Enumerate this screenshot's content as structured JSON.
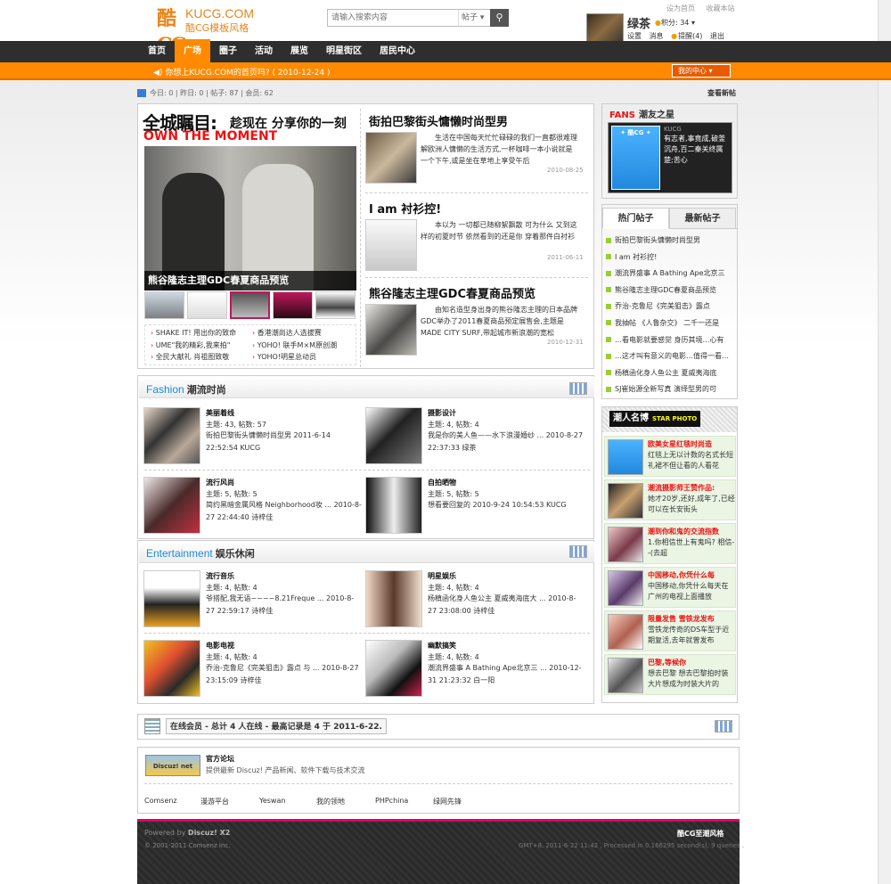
{
  "header": {
    "logo_mark": "酷CG",
    "site_name": "KUCG.COM",
    "site_sub": "酷CG模板风格",
    "top_links": [
      "设为首页",
      "收藏本站"
    ],
    "search": {
      "placeholder": "请输入搜索内容",
      "scope": "帖子",
      "button_icon": "search-icon"
    },
    "user": {
      "name": "绿茶",
      "points_label": "积分: 34",
      "menu": [
        "设置",
        "消息",
        "提醒(4)",
        "退出"
      ]
    }
  },
  "nav": {
    "items": [
      "首页",
      "广场",
      "圈子",
      "活动",
      "展览",
      "明星街区",
      "居民中心"
    ],
    "active": "广场"
  },
  "notice": {
    "text": "你想上KUCG.COM的首页吗?  ( 2010-12-24 )",
    "my_center": "我的中心"
  },
  "stats": {
    "text": "今日: 0  |  昨日: 0  |  帖子: 87  |  会员: 62",
    "newest_link": "查看新帖"
  },
  "feature": {
    "big_title": "全城瞩目:",
    "big_title_sub": "趁现在 分享你的一刻",
    "own": "OWN THE MOMENT",
    "hero_caption": "熊谷隆志主理GDC春夏商品预览",
    "list": [
      "SHAKE IT! 用出你的致命",
      "香港潮尚达人选拔赛",
      "UME\"我的精彩,我来拍\"",
      "YOHO! 联手M×M原创潮",
      "全民大献礼 肖祖图致敬",
      "YOHO!明星总动员"
    ]
  },
  "articles": [
    {
      "title": "街拍巴黎街头慵懒时尚型男",
      "text": "生活在中国每天忙忙碌碌的我们一直都很难理解欧洲人慵懒的生活方式,一杯咖啡一本小说就是一个下午,或是坐在草地上享受午后",
      "date": "2010-08-25"
    },
    {
      "title": "I am 衬衫控!",
      "text": "本以为 一切都已随柳絮飘散 可为什么 又到这样的初夏时节 依然看到的还是你 穿着那件白衬衫",
      "date": "2011-06-11"
    },
    {
      "title": "熊谷隆志主理GDC春夏商品预览",
      "text": "由知名造型身出身的熊谷隆志主理的日本品牌GDC举办了2011春夏商品预定展售会,主题是MADE CITY SURF,带起城市新浪潮的宽松",
      "date": "2010-12-31"
    }
  ],
  "fans": {
    "title": "FANS",
    "title2": "潮友之星",
    "label": "KUCG",
    "text": "有志者,事竟成,破釜沉舟,百二秦关终属楚;苦心"
  },
  "hot": {
    "tabs": [
      "热门帖子",
      "最新帖子"
    ],
    "items": [
      "街拍巴黎街头慵懒时尚型男",
      "I am 衬衫控!",
      "潮流界盛事 A Bathing Ape北京三",
      "熊谷隆志主理GDC春夏商品预览",
      "乔治-克鲁尼《完美狙击》露点",
      "我抽帖 《人鲁杂交》 二千一还是",
      "…看电影就要感觉 身历其境…心有",
      "…这才叫有意义的电影…值得一看…",
      "杨稹函化身人鱼公主 夏威夷海底",
      "SJ崔始源全新写真 演绎型男的可"
    ]
  },
  "star": {
    "tag": "潮人名博",
    "tag_en": "STAR PHOTO",
    "items": [
      {
        "title": "欧美女星红毯时尚造",
        "text": "红毯上无以计数的名式长短礼裙不但让看的人看花"
      },
      {
        "title": "潮流摄影师王赞作品:",
        "text": "她才20岁,还好,成年了,已经可以在长安街头"
      },
      {
        "title": "潮到你和鬼的交流指数",
        "text": "1.你相信世上有鬼吗?      相信--(去超"
      },
      {
        "title": "中国移动,你凭什么每",
        "text": "中国移动,你凭什么每天在广州的电视上面播放"
      },
      {
        "title": "限量发售 雪铁龙发布",
        "text": "雪铁龙传奇的DS车型于近期复活,去年就曾发布"
      },
      {
        "title": "巴黎,等候你",
        "text": "想去巴黎 想去巴黎拍时装大片想成为时装大片的"
      }
    ]
  },
  "sections": [
    {
      "title_en": "Fashion",
      "title_cn": "潮流时尚",
      "forums": [
        {
          "name": "美丽着线",
          "stats": "主题: 43, 帖数: 57",
          "last": "街拍巴黎街头慵懒时尚型男 2011-6-14 22:52:54 KUCG"
        },
        {
          "name": "摄影设计",
          "stats": "主题: 4, 帖数: 4",
          "last": "我是你的美人鱼——水下浪漫婚纱 ... 2010-8-27 22:37:33 绿茶"
        },
        {
          "name": "流行风尚",
          "stats": "主题: 5, 帖数: 5",
          "last": "简约黑暗金属风格 Neighborhood妆 ... 2010-8-27 22:44:40 诗梓佳"
        },
        {
          "name": "自拍晒物",
          "stats": "主题: 5, 帖数: 5",
          "last": "想看要回复的 2010-9-24 10:54:53 KUCG"
        }
      ]
    },
    {
      "title_en": "Entertainment",
      "title_cn": "娱乐休闲",
      "forums": [
        {
          "name": "流行音乐",
          "stats": "主题: 4, 帖数: 4",
          "last": "爷搭配,我无语~~~~8.21Freque ... 2010-8-27 22:59:17 诗梓佳"
        },
        {
          "name": "明星娱乐",
          "stats": "主题: 4, 帖数: 4",
          "last": "杨稹函化身人鱼公主 夏威夷海底大 ... 2010-8-27 23:08:00 诗梓佳"
        },
        {
          "name": "电影电视",
          "stats": "主题: 4, 帖数: 4",
          "last": "乔治-克鲁尼《完美狙击》露点 与 ... 2010-8-27 23:15:09 诗梓佳"
        },
        {
          "name": "幽默搞笑",
          "stats": "主题: 4, 帖数: 4",
          "last": "潮流界盛事 A Bathing Ape北京三 ... 2010-12-31 21:23:32 白一阳"
        }
      ]
    }
  ],
  "online": {
    "text": "在线会员 - 总计 4 人在线 - 最高记录是 4 于 2011-6-22."
  },
  "links": {
    "logo": "Discuz! net",
    "official_title": "官方论坛",
    "official_desc": "提供最新 Discuz! 产品新闻、软件下载与技术交流",
    "friends": [
      "Comsenz",
      "漫游平台",
      "Yeswan",
      "我的领地",
      "PHPchina",
      "绿网先锋"
    ]
  },
  "footer": {
    "powered": "Powered by",
    "powered_brand": "Discuz! X2",
    "copyright": "© 2001-2011 Comsenz Inc.",
    "style_name": "酷CG至潮风格",
    "debug": "GMT+8, 2011-6-22 11:42 , Processed in 0.166295 second(s), 9 queries ."
  },
  "colors": {
    "accent": "#ff8a00",
    "nav": "#2e2e2e",
    "link_blue": "#1e8ad6",
    "footer_stripe": "#e0006a"
  }
}
